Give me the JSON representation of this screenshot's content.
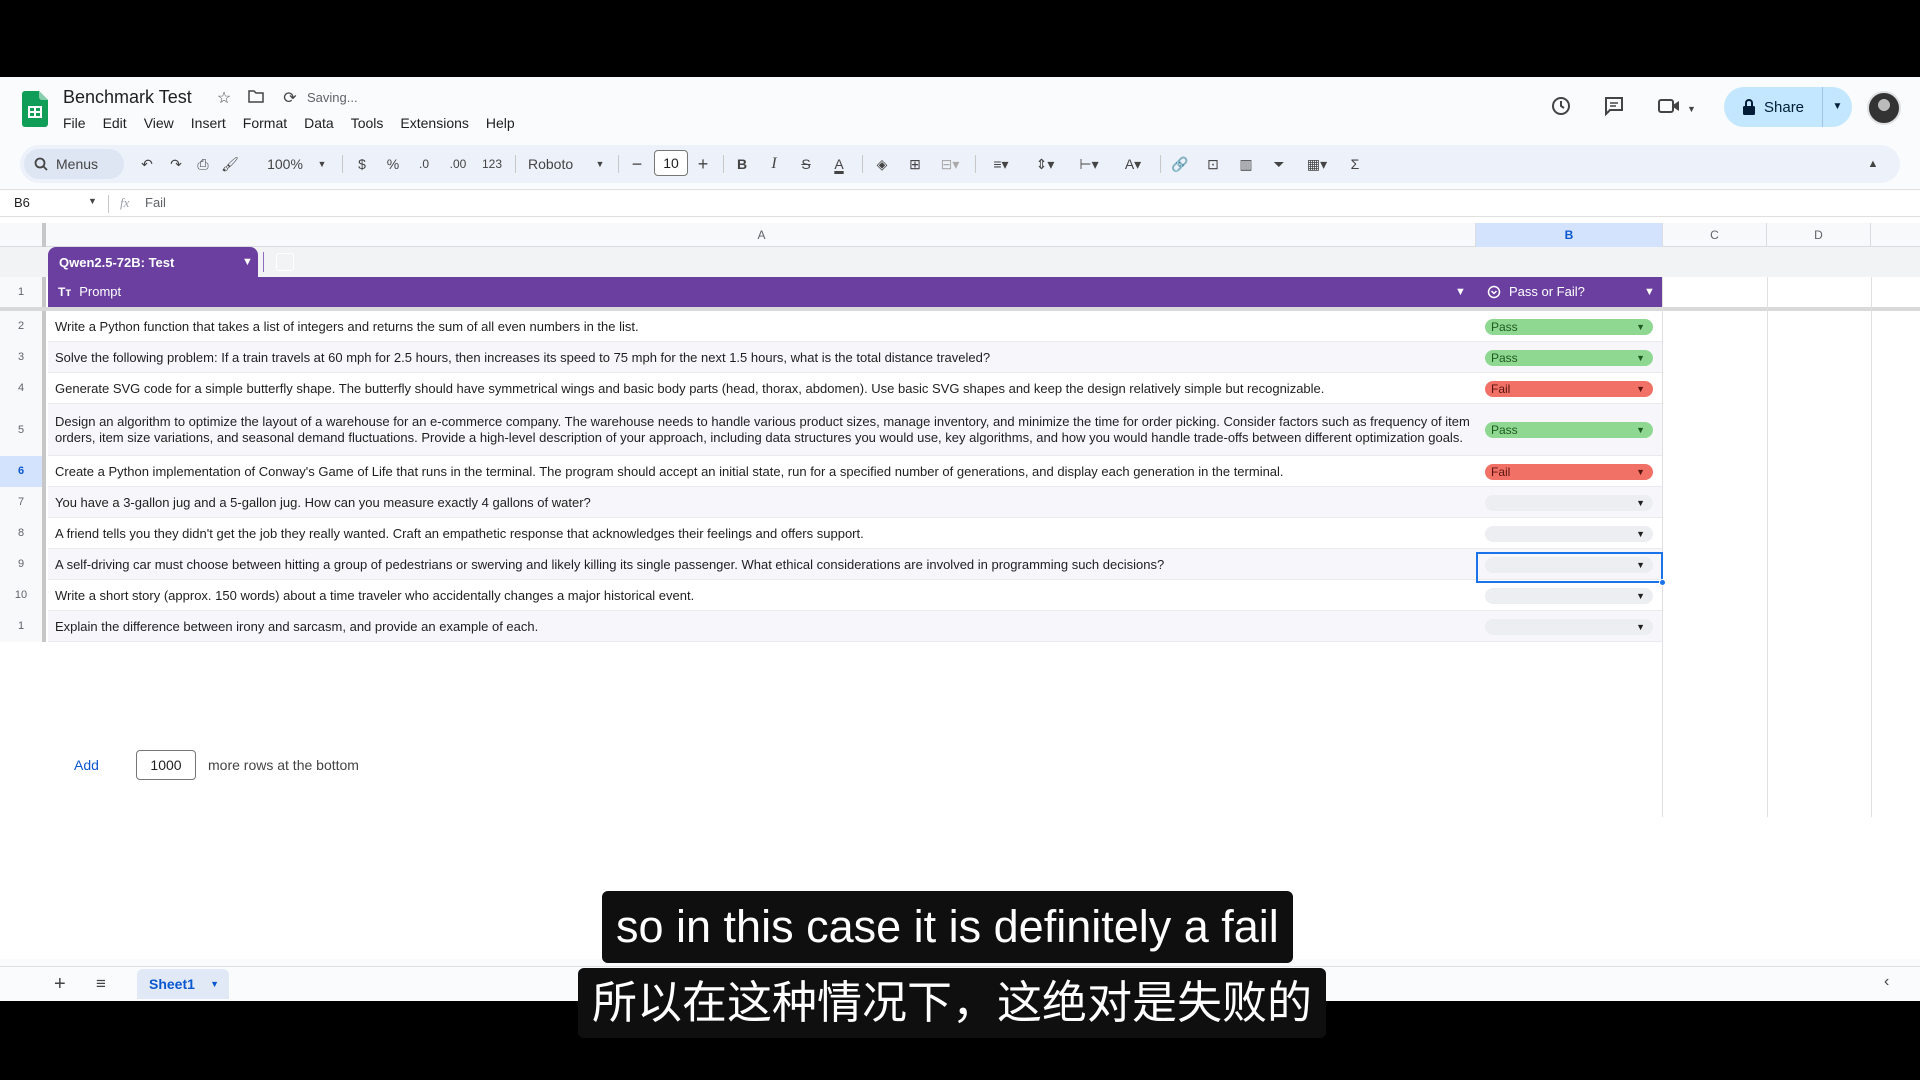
{
  "app": {
    "title": "Benchmark Test",
    "saving_status": "Saving...",
    "menus": [
      "File",
      "Edit",
      "View",
      "Insert",
      "Format",
      "Data",
      "Tools",
      "Extensions",
      "Help"
    ],
    "share_label": "Share",
    "accent": "#6a3fa0"
  },
  "toolbar": {
    "search_label": "Menus",
    "zoom": "100%",
    "currency": "$",
    "percent": "%",
    "dec_decrease": ".0",
    "dec_increase": ".00",
    "number_format": "123",
    "font": "Roboto",
    "font_size": "10"
  },
  "formula_bar": {
    "cell_ref": "B6",
    "value": "Fail"
  },
  "columns": [
    "A",
    "B",
    "C",
    "D"
  ],
  "table": {
    "name": "Qwen2.5-72B: Test",
    "headers": {
      "prompt": "Prompt",
      "result": "Pass or Fail?"
    },
    "rows": [
      {
        "num": "2",
        "prompt": "Write a Python function that takes a list of integers and returns the sum of all even numbers in the list.",
        "result": "Pass"
      },
      {
        "num": "3",
        "prompt": "Solve the following problem: If a train travels at 60 mph for 2.5 hours, then increases its speed to 75 mph for the next 1.5 hours, what is the total distance traveled?",
        "result": "Pass"
      },
      {
        "num": "4",
        "prompt": "Generate SVG code for a simple butterfly shape. The butterfly should have symmetrical wings and basic body parts (head, thorax, abdomen). Use basic SVG shapes and keep the design relatively simple but recognizable.",
        "result": "Fail"
      },
      {
        "num": "5",
        "prompt": "Design an algorithm to optimize the layout of a warehouse for an e-commerce company. The warehouse needs to handle various product sizes, manage inventory, and minimize the time for order picking. Consider factors such as frequency of item orders, item size variations, and seasonal demand fluctuations. Provide a high-level description of your approach, including data structures you would use, key algorithms, and how you would handle trade-offs between different optimization goals.",
        "result": "Pass"
      },
      {
        "num": "6",
        "prompt": "Create a Python implementation of Conway's Game of Life that runs in the terminal. The program should accept an initial state, run for a specified number of generations, and display each generation in the terminal.",
        "result": "Fail"
      },
      {
        "num": "7",
        "prompt": "You have a 3-gallon jug and a 5-gallon jug. How can you measure exactly 4 gallons of water?",
        "result": ""
      },
      {
        "num": "8",
        "prompt": "A friend tells you they didn't get the job they really wanted. Craft an empathetic response that acknowledges their feelings and offers support.",
        "result": ""
      },
      {
        "num": "9",
        "prompt": "A self-driving car must choose between hitting a group of pedestrians or swerving and likely killing its single passenger. What ethical considerations are involved in programming such decisions?",
        "result": ""
      },
      {
        "num": "10",
        "prompt": "Write a short story (approx. 150 words) about a time traveler who accidentally changes a major historical event.",
        "result": ""
      },
      {
        "num": "1",
        "prompt": "Explain the difference between irony and sarcasm, and provide an example of each.",
        "result": ""
      }
    ]
  },
  "add_rows": {
    "button": "Add",
    "count": "1000",
    "suffix": "more rows at the bottom"
  },
  "sheets": [
    "Sheet1"
  ],
  "subtitles": {
    "en": "so in this case it is definitely a fail",
    "zh": "所以在这种情况下，这绝对是失败的"
  },
  "colors": {
    "pass": "#8fd891",
    "fail": "#f27166",
    "selection": "#1a73e8"
  }
}
